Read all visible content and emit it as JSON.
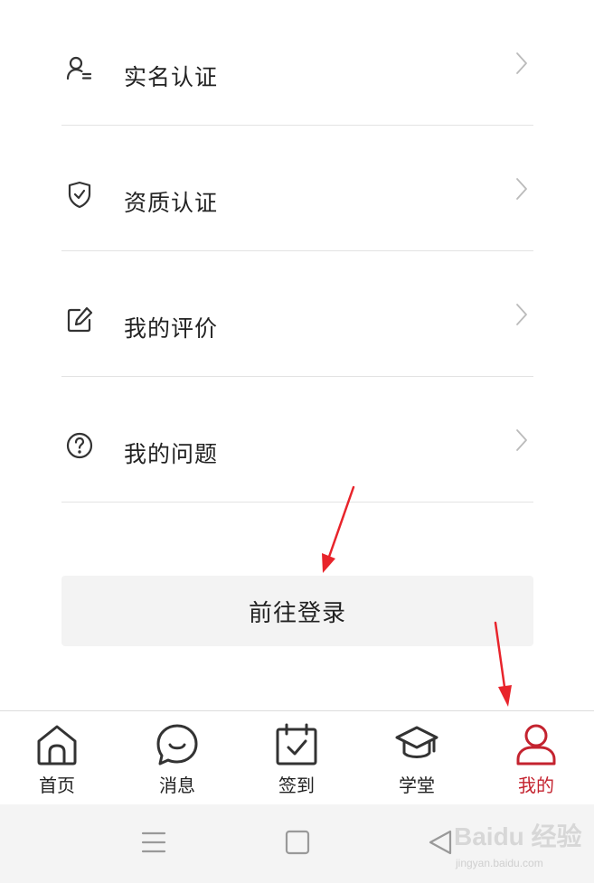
{
  "menu": {
    "items": [
      {
        "label": "实名认证",
        "icon": "user-id-icon"
      },
      {
        "label": "资质认证",
        "icon": "shield-check-icon"
      },
      {
        "label": "我的评价",
        "icon": "edit-icon"
      },
      {
        "label": "我的问题",
        "icon": "question-circle-icon"
      }
    ]
  },
  "login_button": {
    "label": "前往登录"
  },
  "tabbar": {
    "items": [
      {
        "label": "首页",
        "icon": "home-icon",
        "active": false
      },
      {
        "label": "消息",
        "icon": "message-smile-icon",
        "active": false
      },
      {
        "label": "签到",
        "icon": "calendar-check-icon",
        "active": false
      },
      {
        "label": "学堂",
        "icon": "graduation-cap-icon",
        "active": false
      },
      {
        "label": "我的",
        "icon": "user-icon",
        "active": true
      }
    ]
  },
  "system_nav": {
    "buttons": [
      "menu-icon",
      "home-square-icon",
      "back-triangle-icon"
    ]
  },
  "watermark": {
    "main": "Baidu 经验",
    "sub": "jingyan.baidu.com"
  },
  "colors": {
    "accent": "#c4232f",
    "annotation_arrow": "#e8242b",
    "button_bg": "#f3f3f3",
    "divider": "#e3e3e3"
  }
}
